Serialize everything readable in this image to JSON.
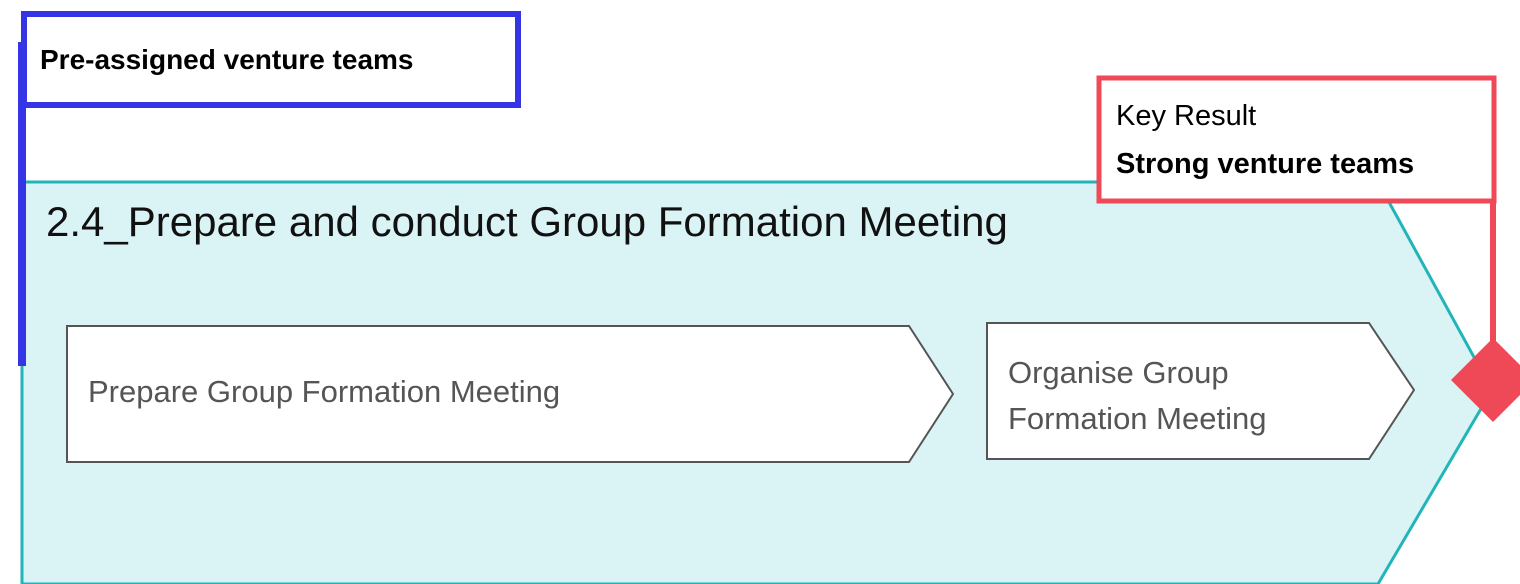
{
  "input": {
    "label": "Pre-assigned venture teams",
    "color": "#3535e6"
  },
  "key_result": {
    "heading": "Key Result",
    "text": "Strong venture teams",
    "color": "#ef4857"
  },
  "phase": {
    "title": "2.4_Prepare and conduct Group Formation Meeting",
    "fill": "#daf4f6",
    "stroke": "#21b5b9"
  },
  "steps": [
    {
      "label": "Prepare Group Formation Meeting"
    },
    {
      "label": "Organise Group Formation Meeting"
    }
  ]
}
